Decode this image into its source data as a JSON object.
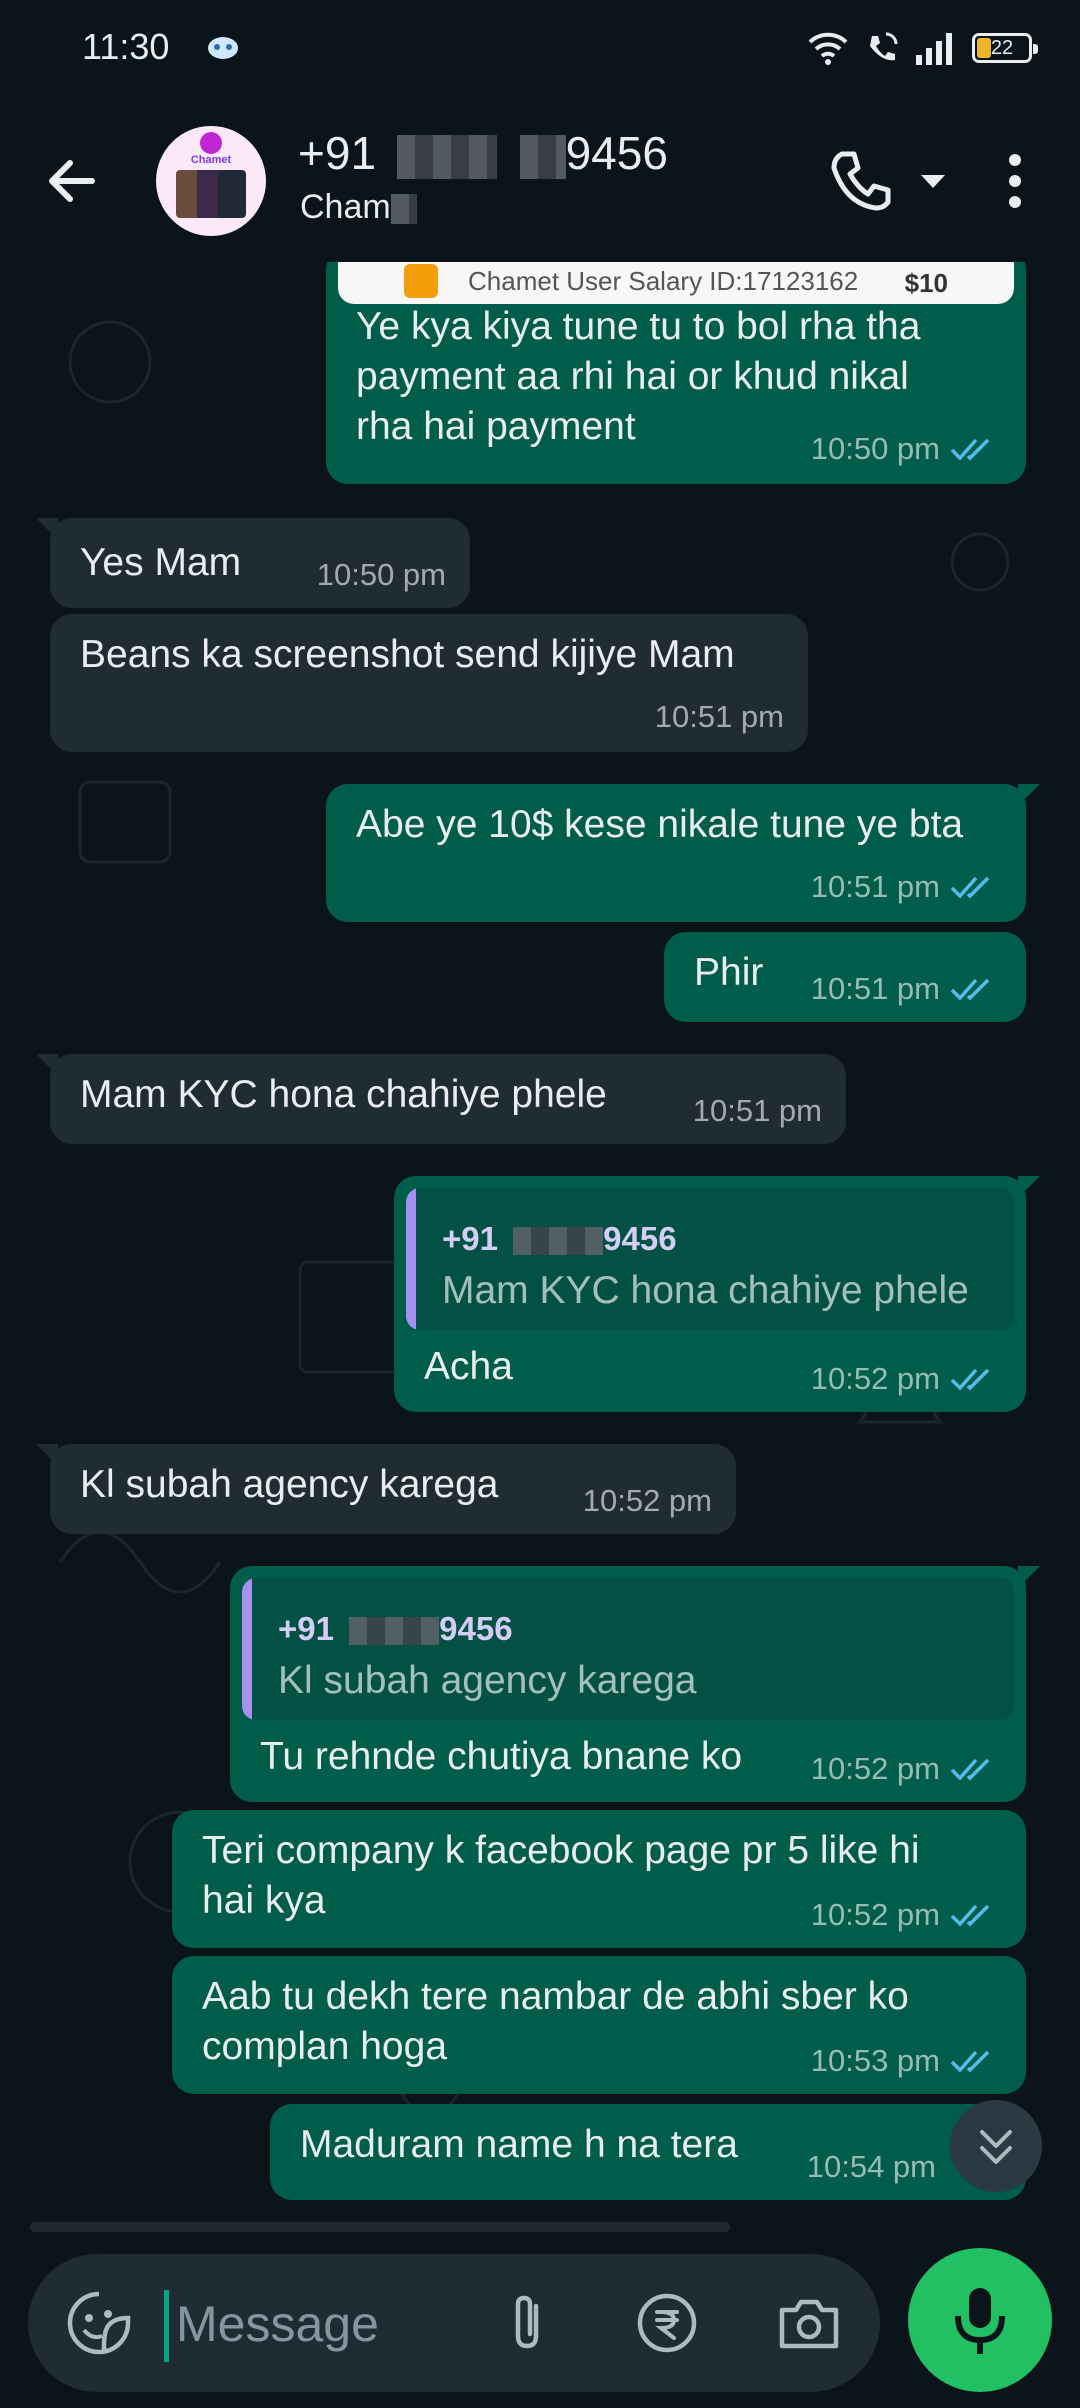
{
  "status_bar": {
    "time": "11:30",
    "battery": "22"
  },
  "header": {
    "avatar_brand": "Chamet",
    "contact_prefix": "+91",
    "contact_suffix": "9456",
    "subtitle_prefix": "Cham"
  },
  "image_preview": {
    "text": "Chamet User Salary ID:17123162",
    "value": "$10"
  },
  "messages": [
    {
      "dir": "out",
      "text": "Ye kya kiya tune tu to bol rha tha\npayment aa rhi hai or khud nikal\nrha hai payment",
      "time": "10:50 pm"
    },
    {
      "dir": "in",
      "text": "Yes Mam",
      "time": "10:50 pm"
    },
    {
      "dir": "in",
      "text": "Beans ka screenshot send kijiye Mam",
      "time": "10:51 pm"
    },
    {
      "dir": "out",
      "text": "Abe ye 10$ kese nikale tune ye bta",
      "time": "10:51 pm"
    },
    {
      "dir": "out",
      "text": "Phir",
      "time": "10:51 pm"
    },
    {
      "dir": "in",
      "text": "Mam KYC hona chahiye phele",
      "time": "10:51 pm"
    },
    {
      "dir": "out",
      "quote_name_prefix": "+91",
      "quote_name_suffix": "9456",
      "quote_text": "Mam KYC hona chahiye phele",
      "text": "Acha",
      "time": "10:52 pm"
    },
    {
      "dir": "in",
      "text": "Kl subah agency karega",
      "time": "10:52 pm"
    },
    {
      "dir": "out",
      "quote_name_prefix": "+91",
      "quote_name_suffix": "9456",
      "quote_text": "Kl subah agency karega",
      "text": "Tu rehnde chutiya bnane ko",
      "time": "10:52 pm"
    },
    {
      "dir": "out",
      "text": "Teri company k facebook page pr 5 like hi\nhai kya",
      "time": "10:52 pm"
    },
    {
      "dir": "out",
      "text": "Aab tu dekh tere nambar de abhi sber ko\ncomplan hoga",
      "time": "10:53 pm"
    },
    {
      "dir": "out",
      "text": "Maduram name h na tera",
      "time": "10:54 pm"
    }
  ],
  "composer": {
    "placeholder": "Message"
  },
  "colors": {
    "accent": "#21c063",
    "outgoing": "#005c4b",
    "incoming": "#202c33",
    "tick_read": "#53bdeb"
  }
}
